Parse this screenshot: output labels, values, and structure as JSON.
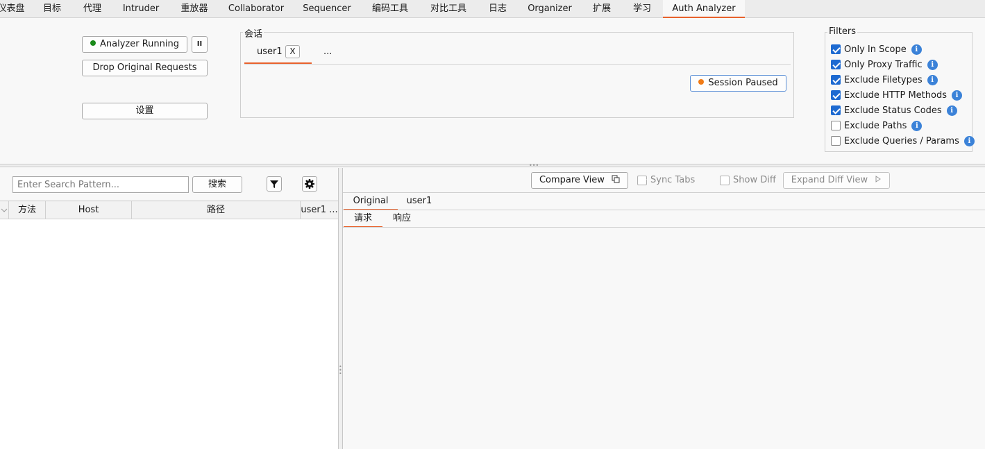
{
  "top_tabs": [
    "仪表盘",
    "目标",
    "代理",
    "Intruder",
    "重放器",
    "Collaborator",
    "Sequencer",
    "编码工具",
    "对比工具",
    "日志",
    "Organizer",
    "扩展",
    "学习",
    "Auth Analyzer"
  ],
  "analyzer": {
    "running_label": "Analyzer Running",
    "pause_label": "II",
    "drop_label": "Drop Original Requests",
    "settings_label": "设置"
  },
  "session": {
    "legend": "会话",
    "tab_name": "user1",
    "close_label": "X",
    "more_label": "...",
    "paused_label": "Session Paused"
  },
  "filters": {
    "legend": "Filters",
    "items": [
      {
        "label": "Only In Scope",
        "checked": true
      },
      {
        "label": "Only Proxy Traffic",
        "checked": true
      },
      {
        "label": "Exclude Filetypes",
        "checked": true
      },
      {
        "label": "Exclude HTTP Methods",
        "checked": true
      },
      {
        "label": "Exclude Status Codes",
        "checked": true
      },
      {
        "label": "Exclude Paths",
        "checked": false
      },
      {
        "label": "Exclude Queries / Params",
        "checked": false
      }
    ]
  },
  "search": {
    "placeholder": "Enter Search Pattern...",
    "button_label": "搜索"
  },
  "table": {
    "columns": [
      "方法",
      "Host",
      "路径",
      "user1 ..."
    ]
  },
  "viewer": {
    "compare_label": "Compare View",
    "sync_label": "Sync Tabs",
    "sync_checked": true,
    "showdiff_label": "Show Diff",
    "showdiff_checked": false,
    "expand_label": "Expand Diff View",
    "tabs": [
      "Original",
      "user1"
    ],
    "subtabs": [
      "请求",
      "响应"
    ]
  },
  "colors": {
    "accent": "#e8612c",
    "running": "#1a8a1a",
    "paused": "#f07b16",
    "check": "#1d6ad1",
    "info": "#3b82d8"
  }
}
